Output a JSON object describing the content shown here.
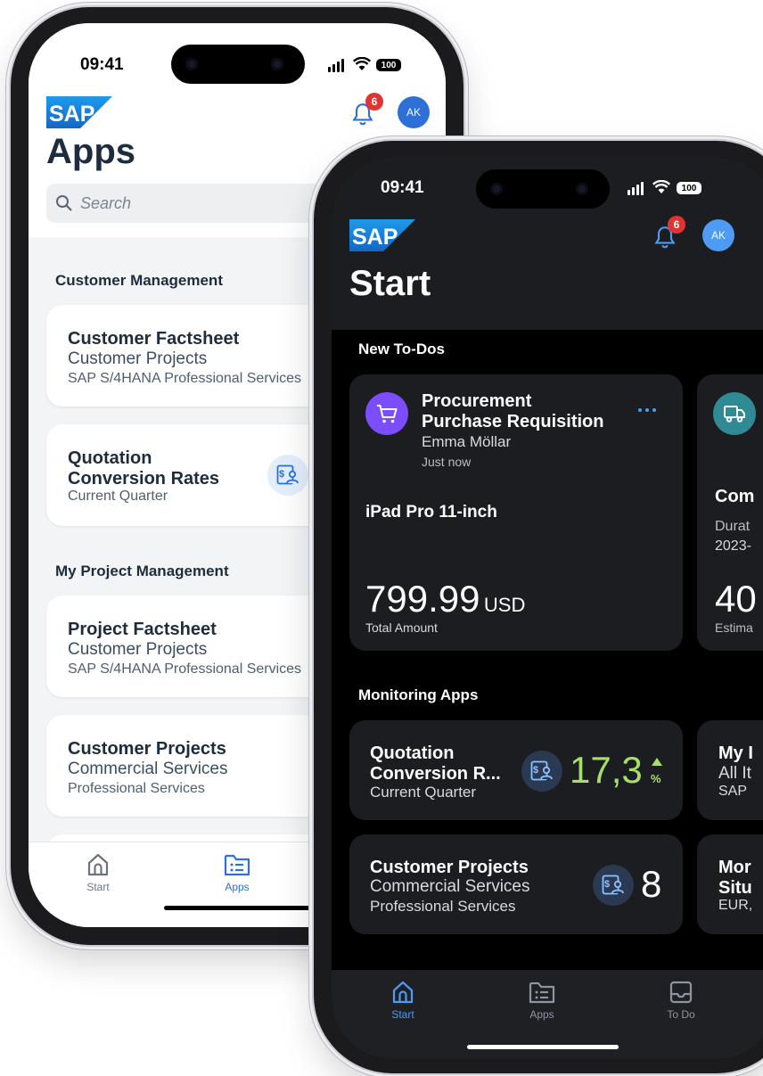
{
  "back_phone": {
    "status": {
      "time": "09:41",
      "battery": "100"
    },
    "brand": "SAP",
    "notification_count": "6",
    "avatar_initials": "AK",
    "title": "Apps",
    "search": {
      "placeholder": "Search"
    },
    "sections": [
      {
        "label": "Customer Management"
      },
      {
        "label": "My Project Management"
      }
    ],
    "cards": [
      {
        "title": "Customer Factsheet",
        "subtitle": "Customer Projects",
        "detail": "SAP S/4HANA Professional Services"
      },
      {
        "title1": "Quotation",
        "title2": "Conversion Rates",
        "subtitle": "Current Quarter",
        "icon": "quotation-icon"
      },
      {
        "title": "Project Factsheet",
        "subtitle": "Customer Projects",
        "detail": "SAP S/4HANA Professional Services"
      },
      {
        "title": "Customer Projects",
        "subtitle": "Commercial Services",
        "detail": "Professional Services"
      }
    ],
    "tabs": [
      {
        "label": "Start",
        "icon": "home-icon"
      },
      {
        "label": "Apps",
        "icon": "apps-icon",
        "active": true
      }
    ]
  },
  "front_phone": {
    "status": {
      "time": "09:41",
      "battery": "100"
    },
    "brand": "SAP",
    "notification_count": "6",
    "avatar_initials": "AK",
    "title": "Start",
    "todos": {
      "section_label": "New To-Dos",
      "card": {
        "title1": "Procurement",
        "title2": "Purchase Requisition",
        "person": "Emma Möllar",
        "time": "Just now",
        "item": "iPad Pro 11-inch",
        "amount": "799.99",
        "currency": "USD",
        "amount_label": "Total Amount",
        "icon": "cart-icon"
      },
      "peek_card": {
        "title": "Com",
        "line1": "Durat",
        "line2": "2023-",
        "value": "40",
        "value_label": "Estima",
        "icon": "truck-icon"
      }
    },
    "monitoring": {
      "section_label": "Monitoring Apps",
      "cards": [
        {
          "title1": "Quotation",
          "title2": "Conversion R...",
          "subtitle": "Current Quarter",
          "value": "17,3",
          "unit": "%",
          "trend": "up"
        },
        {
          "title": "Customer Projects",
          "subtitle": "Commercial Services",
          "detail": "Professional Services",
          "value": "8"
        }
      ],
      "peek_cards": [
        {
          "line1": "My I",
          "line2": "All It",
          "line3": "SAP"
        },
        {
          "line1": "Mor",
          "line2": "Situ",
          "line3": "EUR,"
        }
      ]
    },
    "tabs": [
      {
        "label": "Start",
        "icon": "home-icon",
        "active": true
      },
      {
        "label": "Apps",
        "icon": "apps-icon"
      },
      {
        "label": "To Do",
        "icon": "inbox-icon"
      }
    ]
  },
  "colors": {
    "sap_blue": "#1a7fd4",
    "accent_light": "#2e6fd8",
    "accent_dark": "#4d9bf2",
    "kpi_green": "#a6e06a",
    "badge_red": "#e03434",
    "todo_icon_purple": "#7c4dff",
    "truck_icon_teal": "#2f8a95"
  }
}
